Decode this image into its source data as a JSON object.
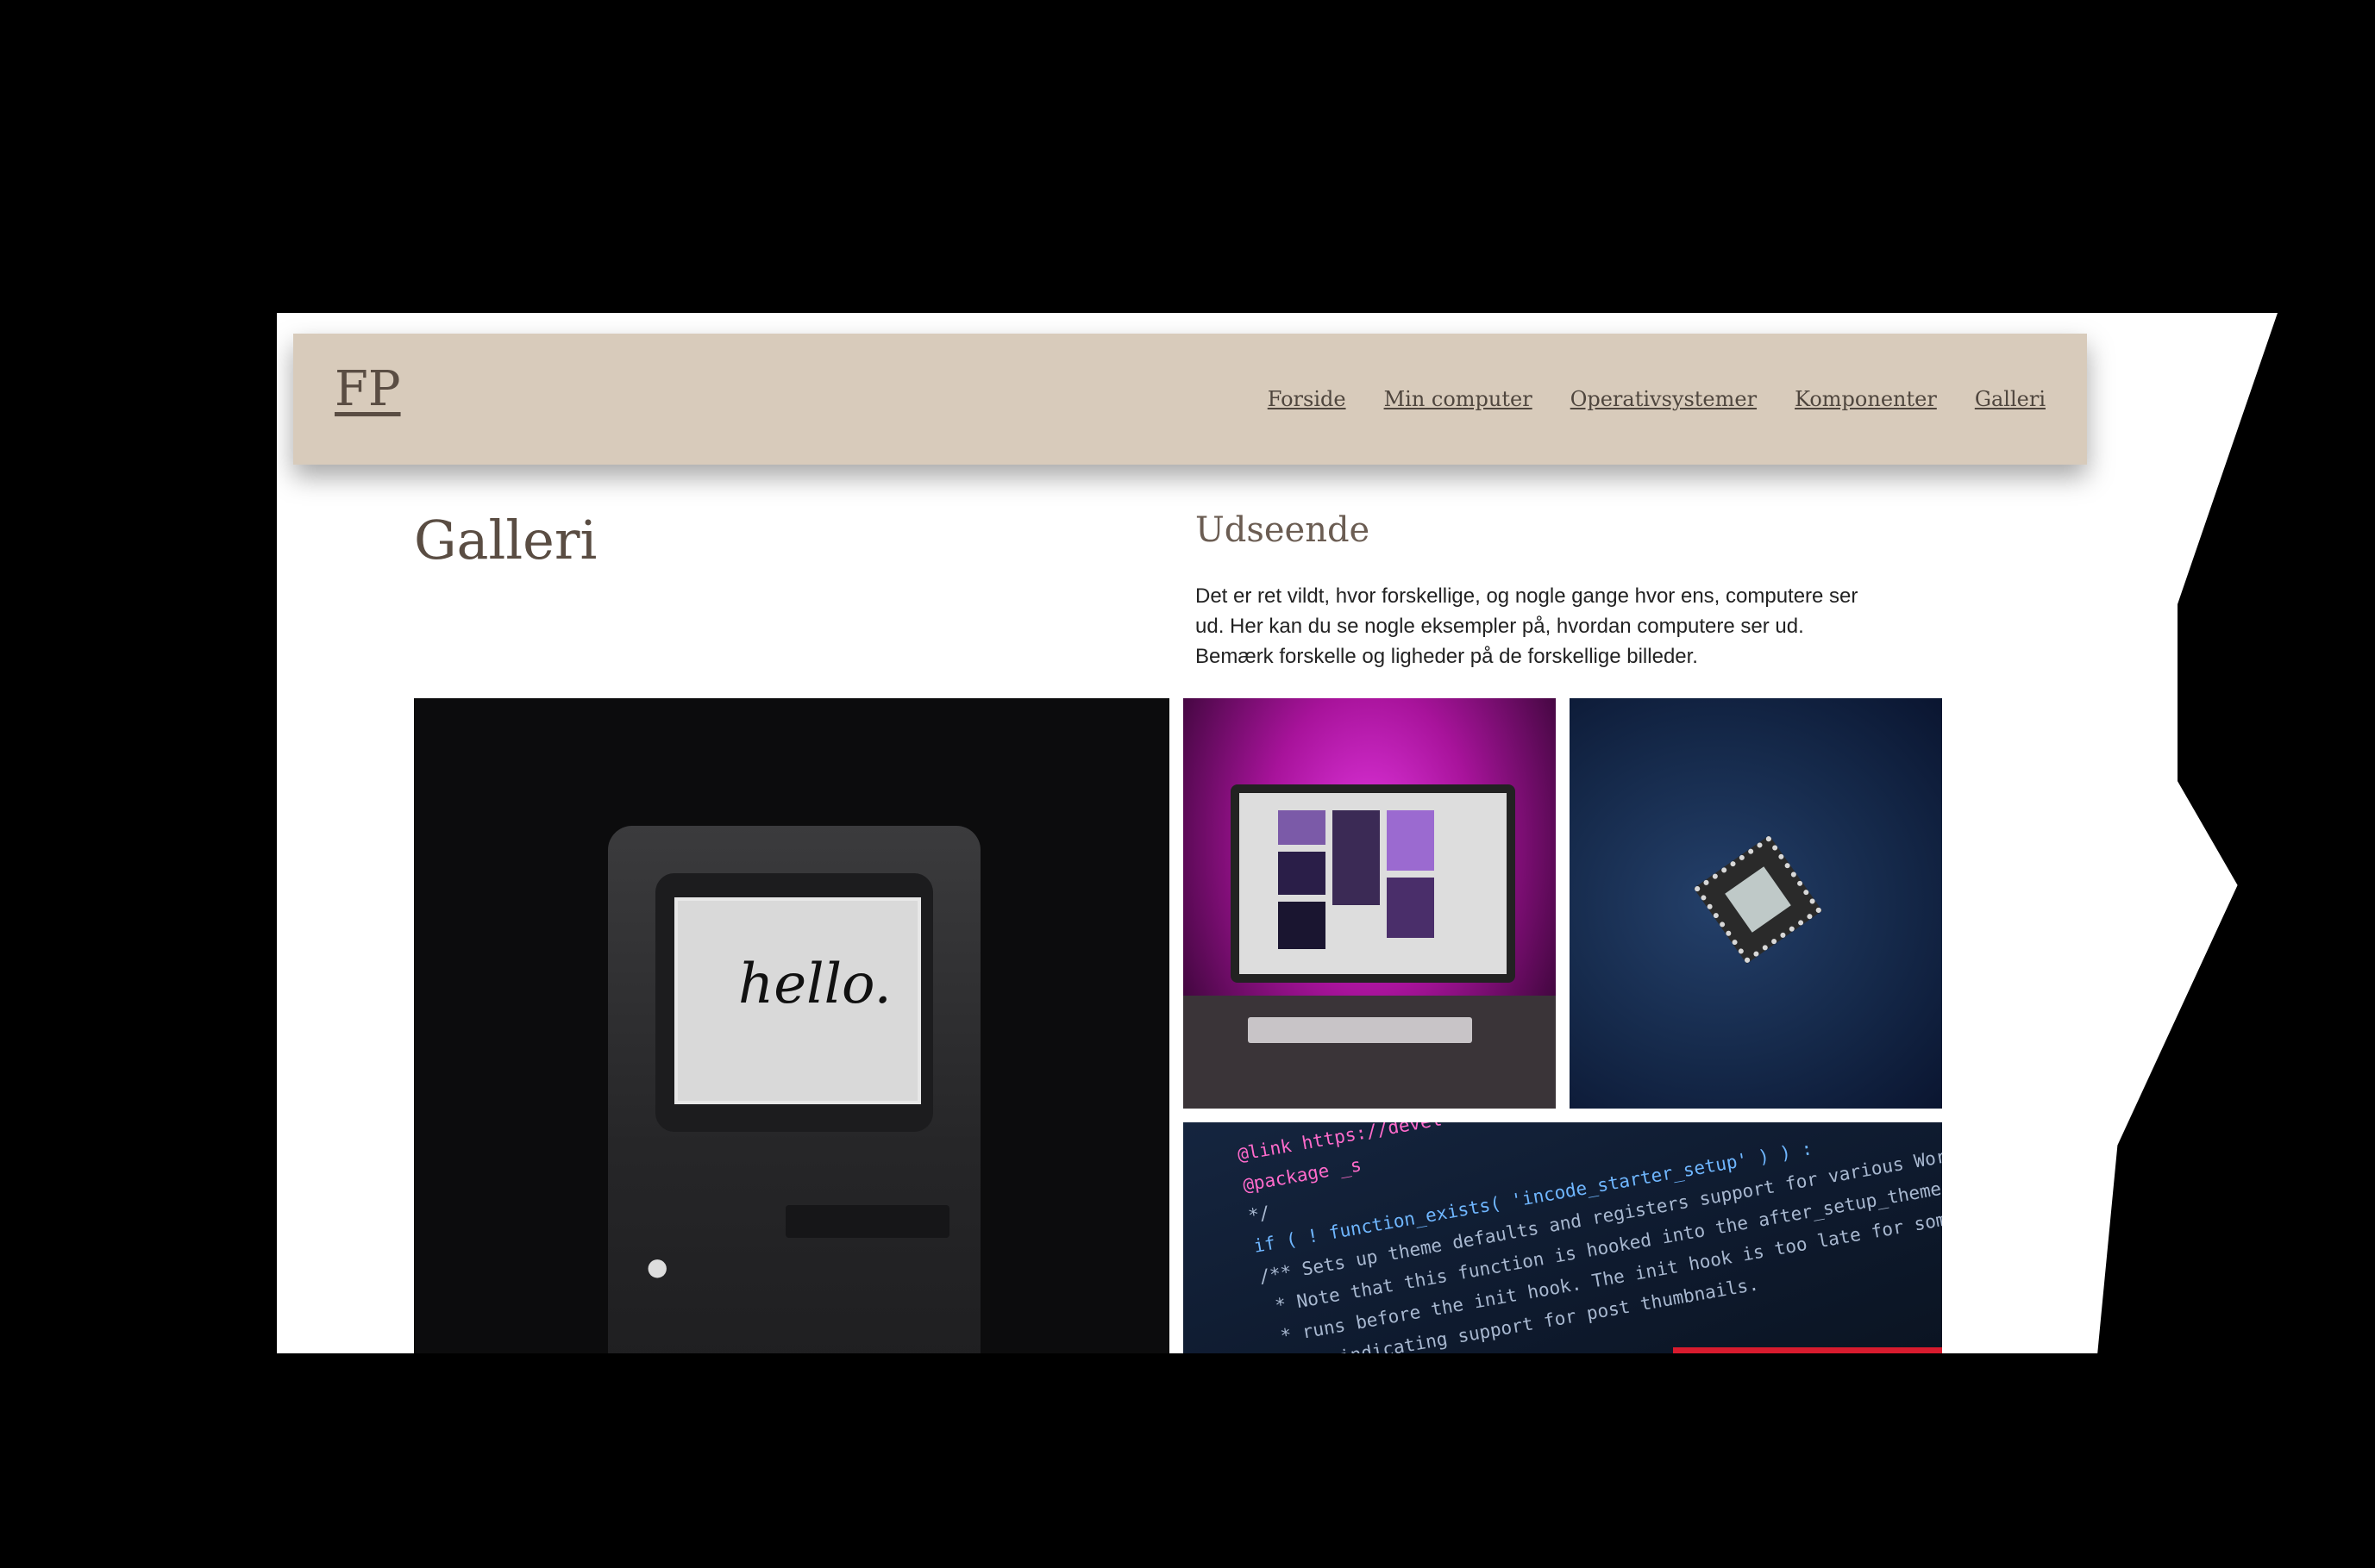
{
  "header": {
    "logo": "FP",
    "nav": [
      "Forside",
      "Min computer",
      "Operativsystemer",
      "Komponenter",
      "Galleri"
    ]
  },
  "main": {
    "title": "Galleri",
    "subtitle": "Udseende",
    "description": "Det er ret vildt, hvor forskellige, og nogle gange hvor ens, computere ser ud. Her kan du se nogle eksempler på, hvordan computere ser ud. Bemærk forskelle og ligheder på de forskellige billeder."
  },
  "gallery": {
    "mac_text": "hello.",
    "code_lines": [
      "@link https://devel",
      "@package _s",
      "*/",
      "if ( ! function_exists( 'incode_starter_setup' ) ) :",
      "/** Sets up theme defaults and registers support for various WordPress fea",
      " * Note that this function is hooked into the after_setup_theme hook, which",
      " * runs before the init hook. The init hook is too late for some features, s",
      " * as indicating support for post thumbnails."
    ]
  },
  "colors": {
    "header_bg": "#d8cbbb",
    "text_brown": "#5a4d43"
  }
}
